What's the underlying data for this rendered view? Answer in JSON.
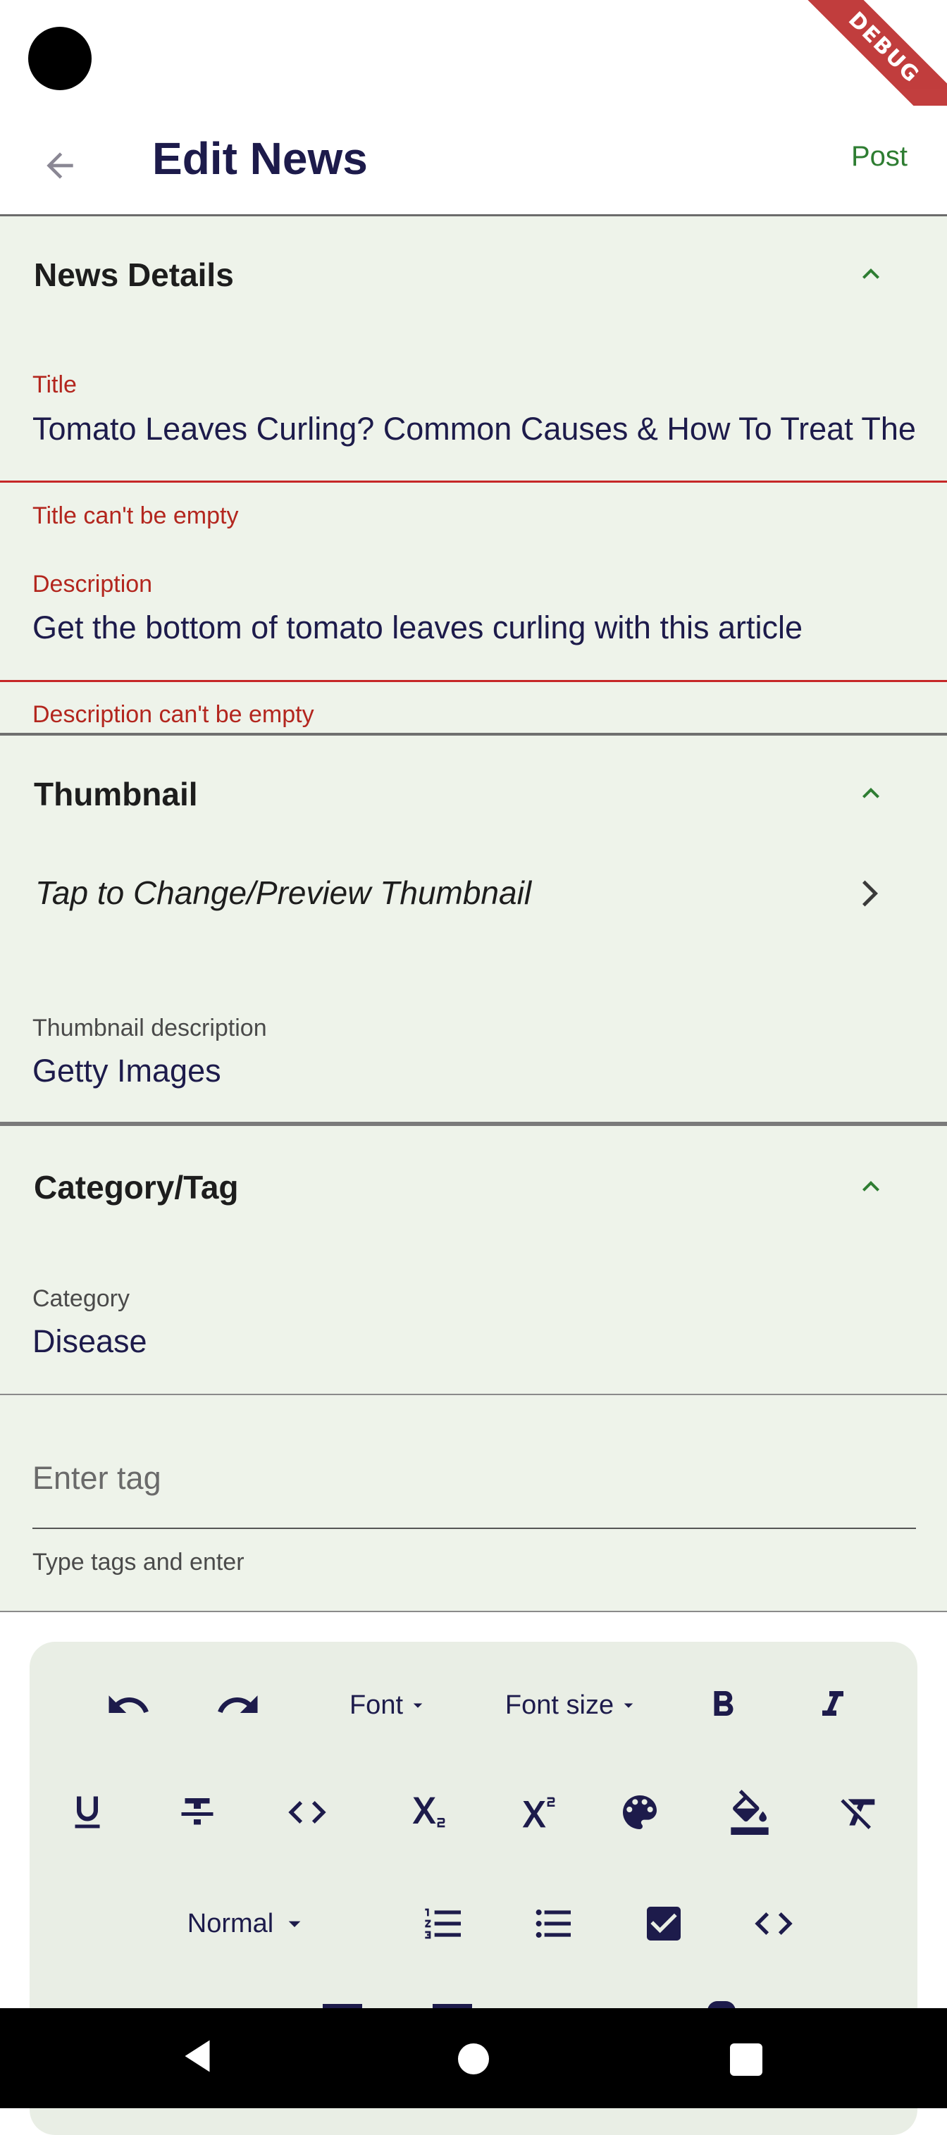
{
  "status_bar": {
    "debug_label": "DEBUG"
  },
  "app_bar": {
    "title": "Edit News",
    "action_label": "Post"
  },
  "news_details": {
    "header": "News Details",
    "title_label": "Title",
    "title_value": "Tomato Leaves Curling? Common Causes & How To Treat Them",
    "title_error": "Title can't be empty",
    "description_label": "Description",
    "description_value": "Get the bottom of tomato leaves curling with this article",
    "description_error": "Description can't be empty"
  },
  "thumbnail": {
    "header": "Thumbnail",
    "tap_label": "Tap to Change/Preview Thumbnail",
    "desc_label": "Thumbnail description",
    "desc_value": "Getty Images"
  },
  "category_tag": {
    "header": "Category/Tag",
    "category_label": "Category",
    "category_value": "Disease",
    "tag_placeholder": "Enter tag",
    "tag_helper": "Type tags and enter"
  },
  "editor_toolbar": {
    "font_label": "Font",
    "font_size_label": "Font size",
    "style_label": "Normal",
    "icons": [
      "undo-icon",
      "redo-icon",
      "bold-icon",
      "italic-icon",
      "underline-icon",
      "strikethrough-icon",
      "inline-code-icon",
      "subscript-icon",
      "superscript-icon",
      "text-color-icon",
      "background-color-icon",
      "clear-format-icon",
      "numbered-list-icon",
      "bulleted-list-icon",
      "checkbox-icon",
      "code-block-icon"
    ]
  },
  "colors": {
    "accent_green": "#2e7d32",
    "error_red": "#b3261e",
    "section_bg": "#eef3ea",
    "title_navy": "#1d1b4b"
  }
}
